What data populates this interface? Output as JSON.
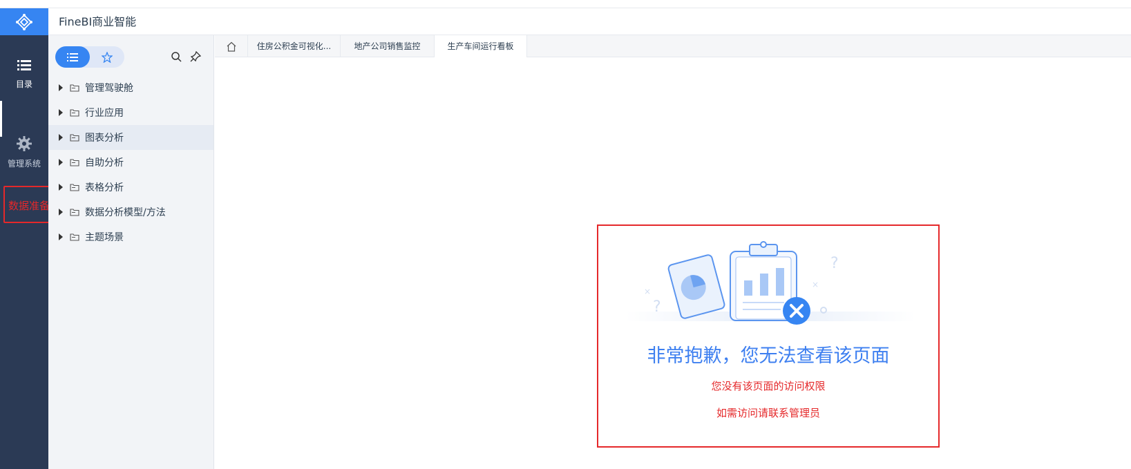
{
  "app": {
    "title": "FineBI商业智能"
  },
  "rail": {
    "items": [
      {
        "label": "目录",
        "icon": "list-icon"
      },
      {
        "label": "管理系统",
        "icon": "gear-icon"
      }
    ],
    "annotation": "数据准备"
  },
  "directory": {
    "items": [
      {
        "label": "管理驾驶舱"
      },
      {
        "label": "行业应用"
      },
      {
        "label": "图表分析"
      },
      {
        "label": "自助分析"
      },
      {
        "label": "表格分析"
      },
      {
        "label": "数据分析模型/方法"
      },
      {
        "label": "主题场景"
      }
    ]
  },
  "tabs": [
    {
      "label": "住房公积金可视化..."
    },
    {
      "label": "地产公司销售监控"
    },
    {
      "label": "生产车间运行看板"
    }
  ],
  "error": {
    "title": "非常抱歉，您无法查看该页面",
    "line1": "您没有该页面的访问权限",
    "line2": "如需访问请联系管理员"
  },
  "colors": {
    "accent": "#3685f2",
    "rail_bg": "#2b3a55",
    "annotation_red": "#e5282a",
    "error_title": "#3d7ff0"
  }
}
